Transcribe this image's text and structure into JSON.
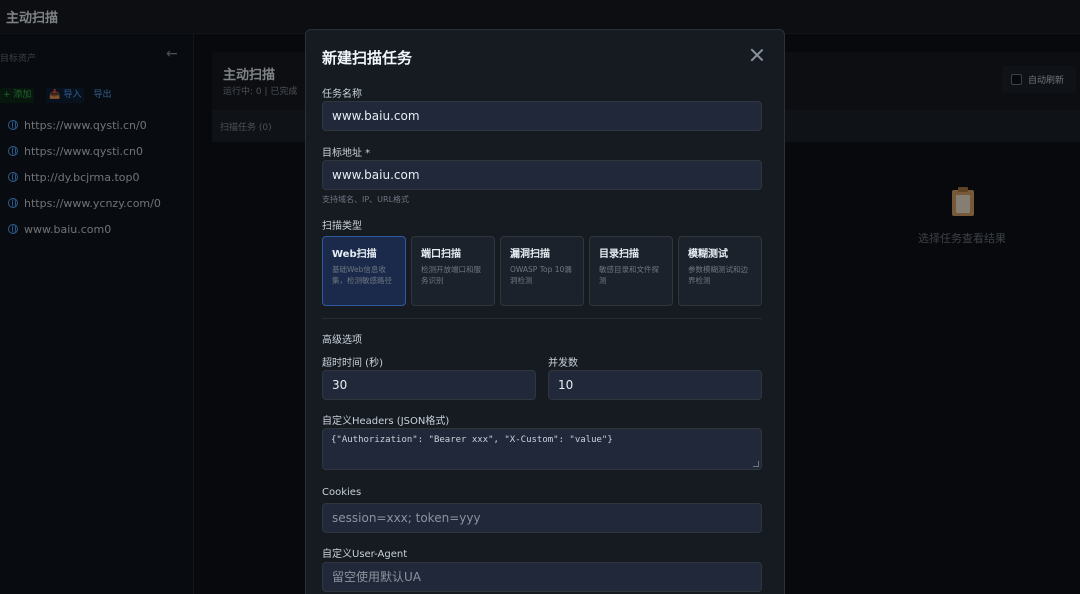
{
  "app": {
    "title": "主动扫描"
  },
  "sidebar": {
    "header": "目标资产",
    "collapse_icon": "←",
    "add_label": "+ 添加",
    "import_label": "📥 导入",
    "export_label": "导出",
    "assets": [
      "https://www.qysti.cn/0",
      "https://www.qysti.cn0",
      "http://dy.bcjrma.top0",
      "https://www.ycnzy.com/0",
      "www.baiu.com0"
    ]
  },
  "main": {
    "title": "主动扫描",
    "subtitle": "运行中: 0 | 已完成",
    "tab_label": "扫描任务 (0)",
    "auto_refresh_label": "自动刷新",
    "empty_text": "选择任务查看结果"
  },
  "modal": {
    "title": "新建扫描任务",
    "task_name": {
      "label": "任务名称",
      "value": "www.baiu.com"
    },
    "target": {
      "label": "目标地址 *",
      "value": "www.baiu.com",
      "hint": "支持域名、IP、URL格式"
    },
    "scan_type": {
      "label": "扫描类型",
      "options": [
        {
          "name": "Web扫描",
          "desc": "基础Web信息收集，检测敏感路径",
          "selected": true
        },
        {
          "name": "端口扫描",
          "desc": "检测开放端口和服务识别",
          "selected": false
        },
        {
          "name": "漏洞扫描",
          "desc": "OWASP Top 10漏洞检测",
          "selected": false
        },
        {
          "name": "目录扫描",
          "desc": "敏感目录和文件探测",
          "selected": false
        },
        {
          "name": "模糊测试",
          "desc": "参数模糊测试和边界检测",
          "selected": false
        }
      ]
    },
    "advanced": {
      "label": "高级选项",
      "timeout": {
        "label": "超时时间 (秒)",
        "value": "30"
      },
      "concurrency": {
        "label": "并发数",
        "value": "10"
      },
      "headers": {
        "label": "自定义Headers (JSON格式)",
        "placeholder": "{\"Authorization\": \"Bearer xxx\", \"X-Custom\": \"value\"}"
      },
      "cookies": {
        "label": "Cookies",
        "placeholder": "session=xxx; token=yyy"
      },
      "user_agent": {
        "label": "自定义User-Agent",
        "placeholder": "留空使用默认UA"
      }
    }
  },
  "colors": {
    "accent": "#58a6ff",
    "success": "#3fb950",
    "selected_card": "#1b2a4a"
  }
}
